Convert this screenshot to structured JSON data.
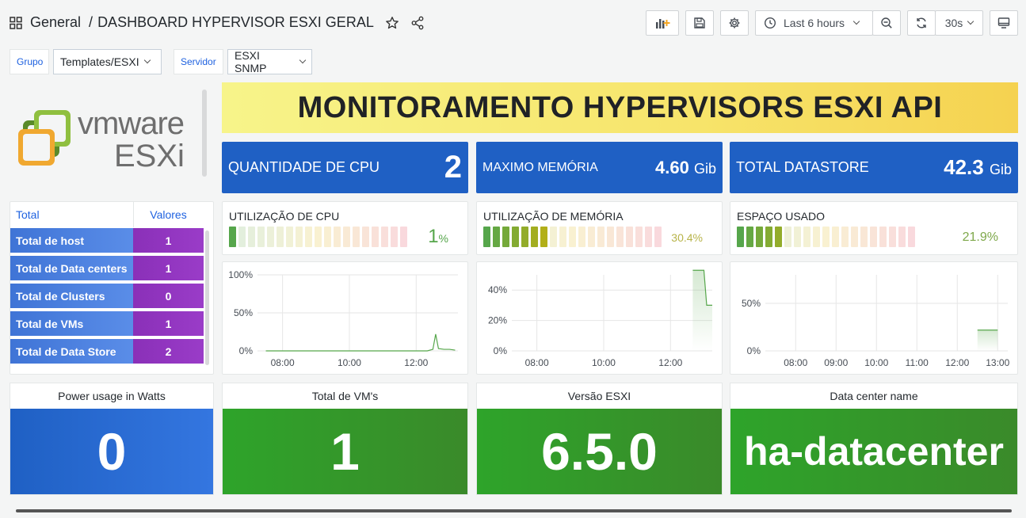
{
  "breadcrumb": {
    "folder": "General",
    "separator": "/",
    "dashboard": "DASHBOARD HYPERVISOR ESXI GERAL"
  },
  "toolbar": {
    "time_range": "Last 6 hours",
    "refresh_interval": "30s"
  },
  "variables": [
    {
      "label": "Grupo",
      "value": "Templates/ESXI"
    },
    {
      "label": "Servidor",
      "value": "ESXI SNMP"
    }
  ],
  "logo": {
    "brand": "vmware",
    "product": "ESXi"
  },
  "banner": {
    "title": "MONITORAMENTO HYPERVISORS ESXI API"
  },
  "stats": [
    {
      "label": "QUANTIDADE DE CPU",
      "value": "2",
      "unit": ""
    },
    {
      "label": "MAXIMO MEMÓRIA",
      "value": "4.60",
      "unit": "Gib"
    },
    {
      "label": "TOTAL DATASTORE",
      "value": "42.3",
      "unit": "Gib"
    }
  ],
  "table": {
    "headers": [
      "Total",
      "Valores"
    ],
    "rows": [
      {
        "name": "Total de host",
        "value": "1"
      },
      {
        "name": "Total de Data centers",
        "value": "1"
      },
      {
        "name": "Total de Clusters",
        "value": "0"
      },
      {
        "name": "Total de VMs",
        "value": "1"
      },
      {
        "name": "Total de Data Store",
        "value": "2"
      }
    ]
  },
  "gauges": [
    {
      "title": "UTILIZAÇÃO DE CPU",
      "value": "1",
      "unit": "%",
      "percent": 1,
      "color": "#56a64b"
    },
    {
      "title": "UTILIZAÇÃO DE MEMÓRIA",
      "value": "30.4%",
      "unit": "",
      "percent": 30.4,
      "color": "#b8b44a"
    },
    {
      "title": "ESPAÇO USADO",
      "value": "21.9%",
      "unit": "",
      "percent": 21.9,
      "color": "#7ea84a"
    }
  ],
  "chart_data": [
    {
      "type": "line",
      "name": "cpu",
      "x_ticks": [
        "08:00",
        "10:00",
        "12:00"
      ],
      "y_ticks": [
        "0%",
        "50%",
        "100%"
      ],
      "ylim": [
        0,
        100
      ],
      "x": [
        "07:30",
        "12:20",
        "12:30",
        "12:35",
        "12:40",
        "12:50",
        "13:00",
        "13:10"
      ],
      "values": [
        0,
        0,
        2,
        22,
        3,
        2,
        2,
        1
      ]
    },
    {
      "type": "area",
      "name": "memory",
      "x_ticks": [
        "08:00",
        "10:00",
        "12:00"
      ],
      "y_ticks": [
        "0%",
        "20%",
        "40%"
      ],
      "ylim": [
        0,
        50
      ],
      "x": [
        "12:40",
        "13:00",
        "13:05",
        "13:15"
      ],
      "values": [
        53,
        53,
        30,
        30
      ]
    },
    {
      "type": "area",
      "name": "disk",
      "x_ticks": [
        "08:00",
        "09:00",
        "10:00",
        "11:00",
        "12:00",
        "13:00"
      ],
      "y_ticks": [
        "0%",
        "50%"
      ],
      "ylim": [
        0,
        80
      ],
      "x": [
        "12:30",
        "13:00"
      ],
      "values": [
        21.9,
        21.9
      ]
    }
  ],
  "bigstats": [
    {
      "title": "Power usage in Watts",
      "value": "0",
      "color": "#1f60c4"
    },
    {
      "title": "Total de VM's",
      "value": "1",
      "color": "#37872d"
    },
    {
      "title": "Versão ESXI",
      "value": "6.5.0",
      "color": "#37872d"
    },
    {
      "title": "Data center name",
      "value": "ha-datacenter",
      "color": "#37872d"
    }
  ]
}
